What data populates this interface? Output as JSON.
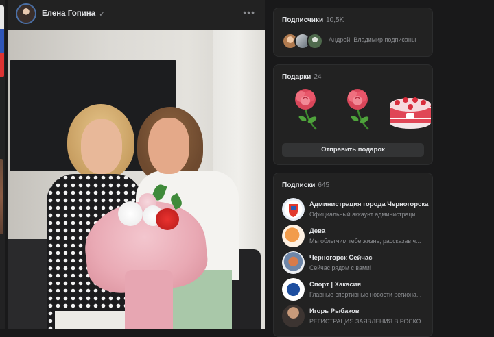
{
  "post": {
    "author": "Елена Гопина",
    "verified_icon": "✓",
    "more_icon": "•••"
  },
  "subscribers": {
    "title": "Подписчики",
    "count": "10,5K",
    "text": "Андрей, Владимир подписаны"
  },
  "gifts": {
    "title": "Подарки",
    "count": "24",
    "items": [
      "rose",
      "rose",
      "cake"
    ],
    "send_label": "Отправить подарок"
  },
  "following": {
    "title": "Подписки",
    "count": "645",
    "groups": [
      {
        "name": "Администрация города Черногорска",
        "desc": "Официальный аккаунт администраци..."
      },
      {
        "name": "Дева",
        "desc": "Мы облегчим тебе жизнь, рассказав ч..."
      },
      {
        "name": "Черногорск Сейчас",
        "desc": "Сейчас рядом с вами!"
      },
      {
        "name": "Спорт | Хакасия",
        "desc": "Главные спортивные новости региона..."
      },
      {
        "name": "Игорь Рыбаков",
        "desc": "РЕГИСТРАЦИЯ ЗАЯВЛЕНИЯ В РОСКО..."
      }
    ]
  },
  "colors": {
    "background": "#19191a",
    "card": "#222222",
    "text_primary": "#e1e3e6",
    "text_secondary": "#8b8d91"
  }
}
